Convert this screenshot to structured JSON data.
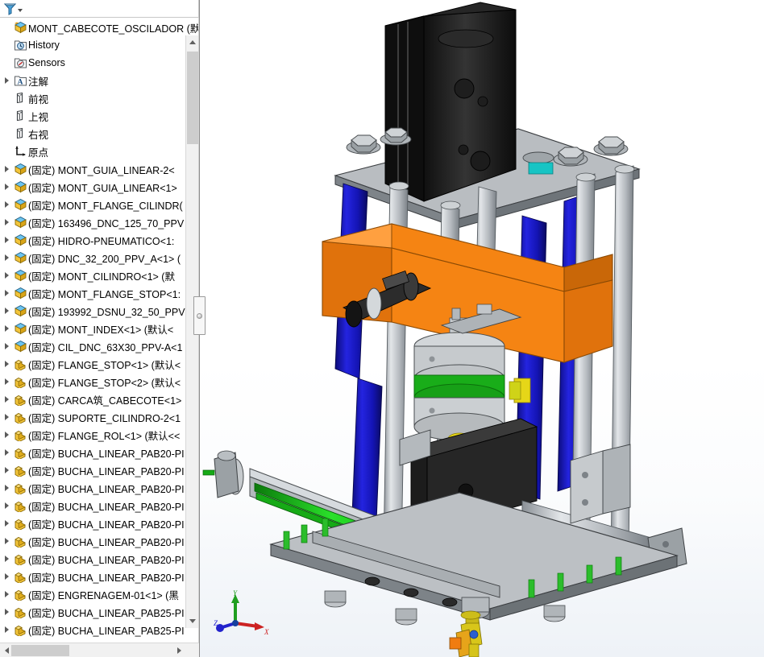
{
  "panel": {
    "filter": {
      "icon": "filter-funnel-icon",
      "dropdown_icon": "chevron-down-icon"
    },
    "root": {
      "label": "MONT_CABECOTE_OSCILADOR  (默",
      "icon": "assembly-icon"
    },
    "fixed_prefix": "(固定)",
    "static_items": [
      {
        "label": "History",
        "icon": "history-folder-icon",
        "expandable": false,
        "indent": 1
      },
      {
        "label": "Sensors",
        "icon": "sensors-folder-icon",
        "expandable": false,
        "indent": 1
      },
      {
        "label": "注解",
        "icon": "annotations-folder-icon",
        "expandable": true,
        "indent": 1
      },
      {
        "label": "前视",
        "icon": "plane-icon",
        "expandable": false,
        "indent": 1
      },
      {
        "label": "上视",
        "icon": "plane-icon",
        "expandable": false,
        "indent": 1
      },
      {
        "label": "右视",
        "icon": "plane-icon",
        "expandable": false,
        "indent": 1
      },
      {
        "label": "原点",
        "icon": "origin-icon",
        "expandable": false,
        "indent": 1
      }
    ],
    "components": [
      {
        "label": "(固定) MONT_GUIA_LINEAR-2<",
        "icon": "subassembly-icon"
      },
      {
        "label": "(固定) MONT_GUIA_LINEAR<1>",
        "icon": "subassembly-icon"
      },
      {
        "label": "(固定) MONT_FLANGE_CILINDR(",
        "icon": "subassembly-icon"
      },
      {
        "label": "(固定) 163496_DNC_125_70_PPV",
        "icon": "subassembly-icon"
      },
      {
        "label": "(固定) HIDRO-PNEUMATICO<1:",
        "icon": "subassembly-icon"
      },
      {
        "label": "(固定) DNC_32_200_PPV_A<1>  (",
        "icon": "subassembly-icon"
      },
      {
        "label": "(固定) MONT_CILINDRO<1>  (默",
        "icon": "subassembly-icon"
      },
      {
        "label": "(固定) MONT_FLANGE_STOP<1:",
        "icon": "subassembly-icon"
      },
      {
        "label": "(固定) 193992_DSNU_32_50_PPV",
        "icon": "subassembly-icon"
      },
      {
        "label": "(固定) MONT_INDEX<1>  (默认<",
        "icon": "subassembly-icon"
      },
      {
        "label": "(固定) CIL_DNC_63X30_PPV-A<1",
        "icon": "subassembly-icon"
      },
      {
        "label": "(固定) FLANGE_STOP<1>  (默认<",
        "icon": "part-icon"
      },
      {
        "label": "(固定) FLANGE_STOP<2>  (默认<",
        "icon": "part-icon"
      },
      {
        "label": "(固定) CARCA筑_CABECOTE<1>",
        "icon": "part-icon"
      },
      {
        "label": "(固定) SUPORTE_CILINDRO-2<1",
        "icon": "part-icon"
      },
      {
        "label": "(固定) FLANGE_ROL<1>  (默认<<",
        "icon": "part-icon"
      },
      {
        "label": "(固定) BUCHA_LINEAR_PAB20-PI",
        "icon": "part-icon"
      },
      {
        "label": "(固定) BUCHA_LINEAR_PAB20-PI",
        "icon": "part-icon"
      },
      {
        "label": "(固定) BUCHA_LINEAR_PAB20-PI",
        "icon": "part-icon"
      },
      {
        "label": "(固定) BUCHA_LINEAR_PAB20-PI",
        "icon": "part-icon"
      },
      {
        "label": "(固定) BUCHA_LINEAR_PAB20-PI",
        "icon": "part-icon"
      },
      {
        "label": "(固定) BUCHA_LINEAR_PAB20-PI",
        "icon": "part-icon"
      },
      {
        "label": "(固定) BUCHA_LINEAR_PAB20-PI",
        "icon": "part-icon"
      },
      {
        "label": "(固定) BUCHA_LINEAR_PAB20-PI",
        "icon": "part-icon"
      },
      {
        "label": "(固定) ENGRENAGEM-01<1>  (黑",
        "icon": "part-icon"
      },
      {
        "label": "(固定) BUCHA_LINEAR_PAB25-PI",
        "icon": "part-icon"
      },
      {
        "label": "(固定) BUCHA_LINEAR_PAB25-PI",
        "icon": "part-icon"
      }
    ],
    "scrollbar": {
      "v_up_icon": "scroll-up-arrow-icon",
      "v_down_icon": "scroll-down-arrow-icon",
      "h_left_icon": "scroll-left-arrow-icon",
      "h_right_icon": "scroll-right-arrow-icon"
    },
    "splitter_icon": "panel-collapse-handle-icon"
  },
  "viewport": {
    "triad": {
      "x_label": "X",
      "y_label": "Y",
      "z_label": "Z",
      "x_color": "#cc2222",
      "y_color": "#1f9e1f",
      "z_color": "#2222cc"
    },
    "model_name": "MONT_CABECOTE_OSCILADOR",
    "colors": {
      "steel_light": "#c3c6c9",
      "steel_mid": "#9aa0a5",
      "steel_dark": "#6f767c",
      "blue": "#1919d2",
      "blue_dark": "#0f0f8c",
      "orange": "#f07c10",
      "orange_dark": "#b85a06",
      "green": "#18c018",
      "green_dark": "#0e8c0e",
      "black": "#1a1a1a",
      "black_mid": "#2e2e2e",
      "yellow": "#e8d21a",
      "cyan": "#17c4c4",
      "background_top": "#ffffff",
      "background_bottom": "#eef2f7"
    }
  }
}
